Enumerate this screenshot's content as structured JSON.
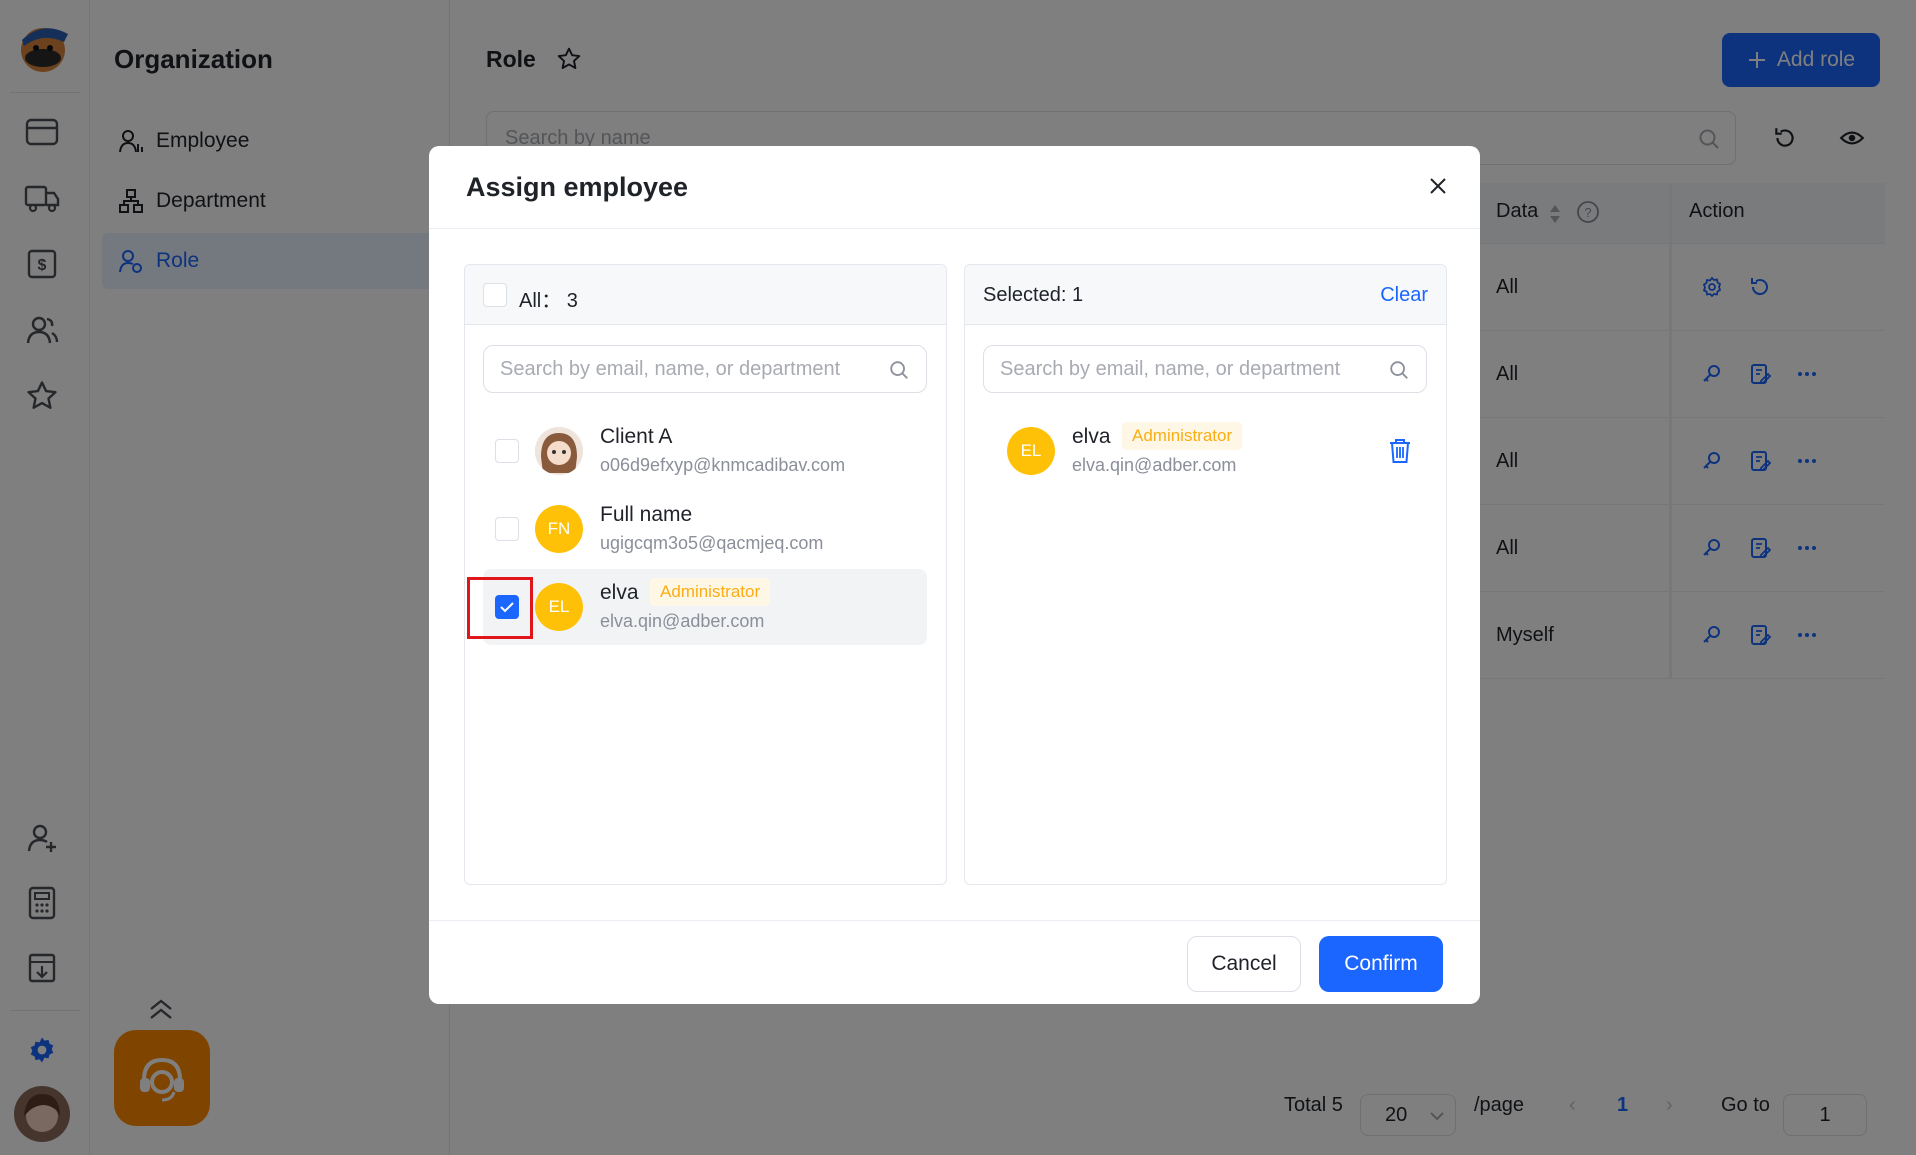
{
  "sidebar": {
    "title": "Organization",
    "items": [
      {
        "label": "Employee"
      },
      {
        "label": "Department"
      },
      {
        "label": "Role"
      }
    ]
  },
  "header": {
    "title": "Role",
    "add_role_label": "Add role"
  },
  "search": {
    "placeholder": "Search by name"
  },
  "table": {
    "headers": {
      "data": "Data",
      "action": "Action"
    },
    "rows": [
      {
        "data": "All"
      },
      {
        "data": "All"
      },
      {
        "data": "All"
      },
      {
        "data": "All"
      },
      {
        "data": "Myself"
      }
    ]
  },
  "pagination": {
    "total": "Total 5",
    "page_size": "20",
    "per_page": "/page",
    "current": "1",
    "goto_label": "Go to",
    "goto_value": "1"
  },
  "dialog": {
    "title": "Assign employee",
    "left_panel": {
      "all_label": "All： 3",
      "search_placeholder": "Search by email, name, or department",
      "employees": [
        {
          "name": "Client A",
          "email": "o06d9efxyp@knmcadibav.com",
          "initials": "",
          "badge": "",
          "checked": false
        },
        {
          "name": "Full name",
          "email": "ugigcqm3o5@qacmjeq.com",
          "initials": "FN",
          "badge": "",
          "checked": false
        },
        {
          "name": "elva",
          "email": "elva.qin@adber.com",
          "initials": "EL",
          "badge": "Administrator",
          "checked": true
        }
      ]
    },
    "right_panel": {
      "selected_label": "Selected: 1",
      "clear_label": "Clear",
      "search_placeholder": "Search by email, name, or department",
      "selected": [
        {
          "name": "elva",
          "email": "elva.qin@adber.com",
          "initials": "EL",
          "badge": "Administrator"
        }
      ]
    },
    "cancel_label": "Cancel",
    "confirm_label": "Confirm"
  },
  "colors": {
    "accent": "#1a66ff",
    "avatar": "#ffc107",
    "badge_text": "#faad14",
    "help": "#ff8a00",
    "highlight": "#e0161b"
  }
}
